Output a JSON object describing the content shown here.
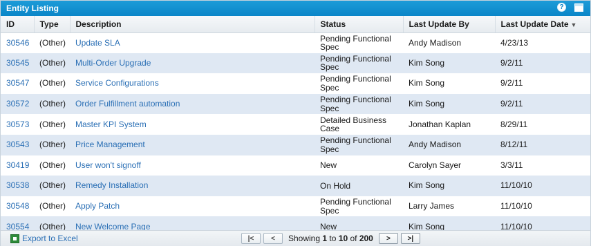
{
  "panel": {
    "title": "Entity Listing"
  },
  "columns": [
    "ID",
    "Type",
    "Description",
    "Status",
    "Last Update By",
    "Last Update Date"
  ],
  "sort": {
    "column": "Last Update Date",
    "direction": "descending"
  },
  "rows": [
    {
      "id": "30546",
      "type": "(Other)",
      "description": "Update SLA",
      "status": "Pending Functional Spec",
      "updated_by": "Andy Madison",
      "updated_date": "4/23/13"
    },
    {
      "id": "30545",
      "type": "(Other)",
      "description": "Multi-Order Upgrade",
      "status": "Pending Functional Spec",
      "updated_by": "Kim Song",
      "updated_date": "9/2/11"
    },
    {
      "id": "30547",
      "type": "(Other)",
      "description": "Service Configurations",
      "status": "Pending Functional Spec",
      "updated_by": "Kim Song",
      "updated_date": "9/2/11"
    },
    {
      "id": "30572",
      "type": "(Other)",
      "description": "Order Fulfillment automation",
      "status": "Pending Functional Spec",
      "updated_by": "Kim Song",
      "updated_date": "9/2/11"
    },
    {
      "id": "30573",
      "type": "(Other)",
      "description": "Master KPI System",
      "status": "Detailed Business Case",
      "updated_by": "Jonathan Kaplan",
      "updated_date": "8/29/11"
    },
    {
      "id": "30543",
      "type": "(Other)",
      "description": "Price Management",
      "status": "Pending Functional Spec",
      "updated_by": "Andy Madison",
      "updated_date": "8/12/11"
    },
    {
      "id": "30419",
      "type": "(Other)",
      "description": "User won't signoff",
      "status": "New",
      "updated_by": "Carolyn Sayer",
      "updated_date": "3/3/11"
    },
    {
      "id": "30538",
      "type": "(Other)",
      "description": "Remedy Installation",
      "status": "On Hold",
      "updated_by": "Kim Song",
      "updated_date": "11/10/10"
    },
    {
      "id": "30548",
      "type": "(Other)",
      "description": "Apply Patch",
      "status": "Pending Functional Spec",
      "updated_by": "Larry James",
      "updated_date": "11/10/10"
    },
    {
      "id": "30554",
      "type": "(Other)",
      "description": "New Welcome Page",
      "status": "New",
      "updated_by": "Kim Song",
      "updated_date": "11/10/10"
    }
  ],
  "footer": {
    "export_label": "Export to Excel",
    "showing_prefix": "Showing",
    "range_start": "1",
    "to_word": "to",
    "range_end": "10",
    "of_word": "of",
    "total": "200"
  },
  "colors": {
    "header_bar": "#0a86c8",
    "link": "#2a6fb5",
    "alt_row": "#dfe8f3"
  }
}
